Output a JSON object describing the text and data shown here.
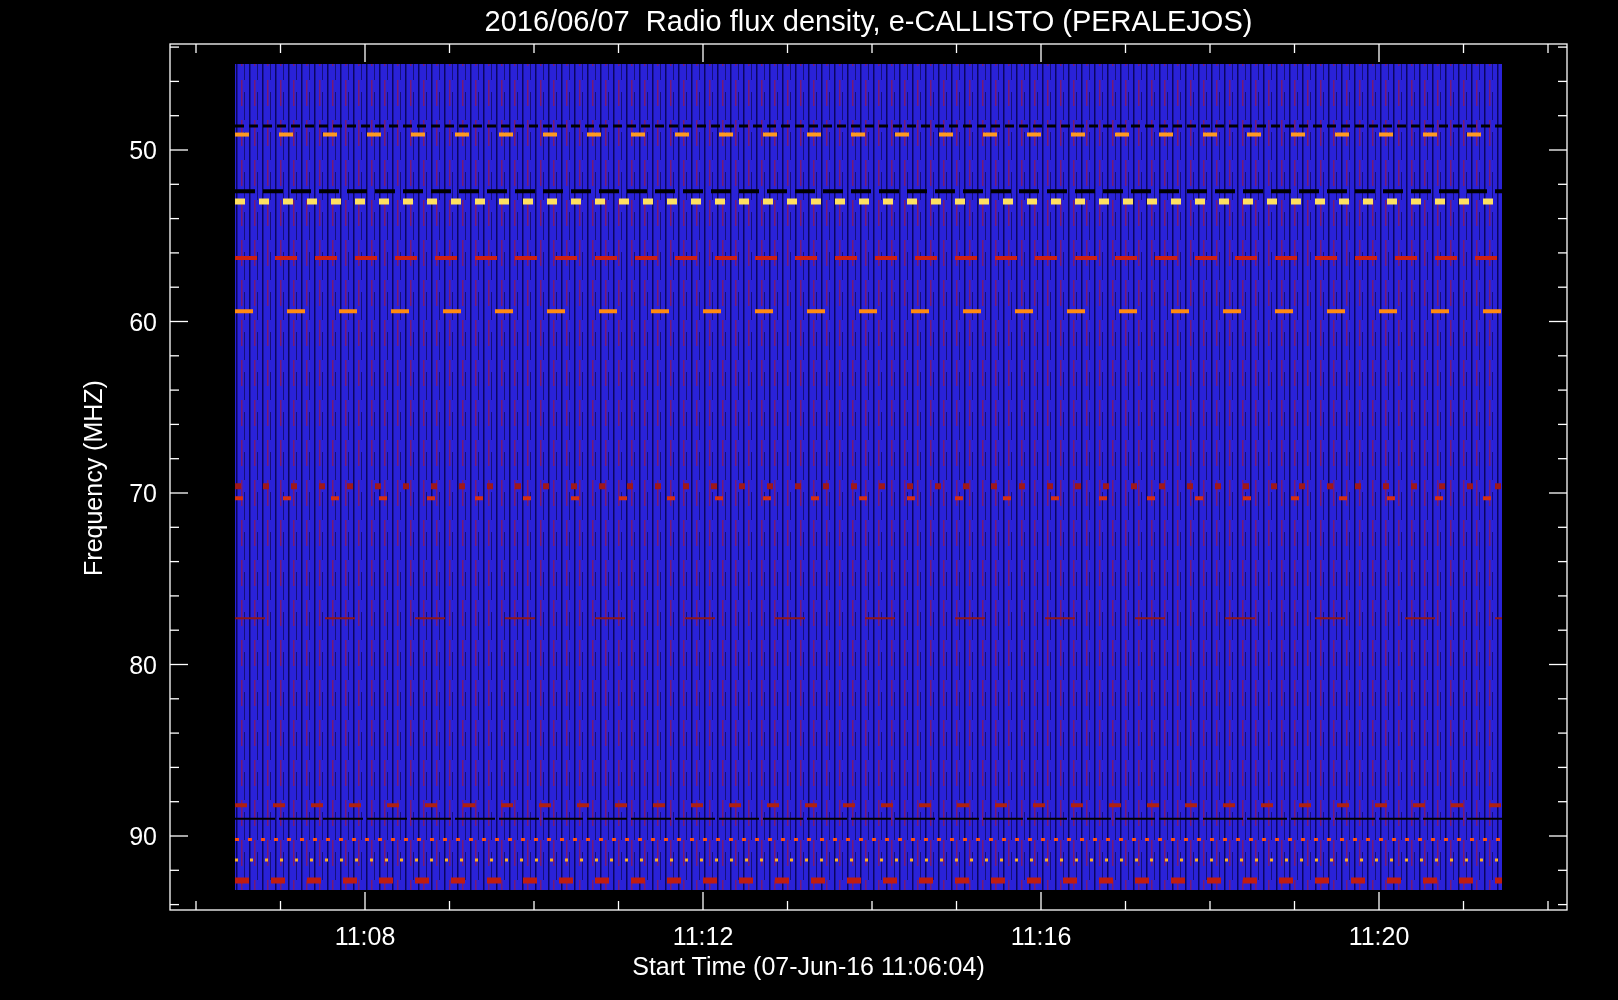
{
  "title": "2016/06/07  Radio flux density, e-CALLISTO (PERALEJOS)",
  "y_axis": {
    "label": "Frequency (MHZ)",
    "ticks": [
      "50",
      "60",
      "70",
      "80",
      "90"
    ]
  },
  "x_axis": {
    "label": "Start Time (07-Jun-16 11:06:04)",
    "ticks": [
      "11:08",
      "11:12",
      "11:16",
      "11:20"
    ]
  }
}
